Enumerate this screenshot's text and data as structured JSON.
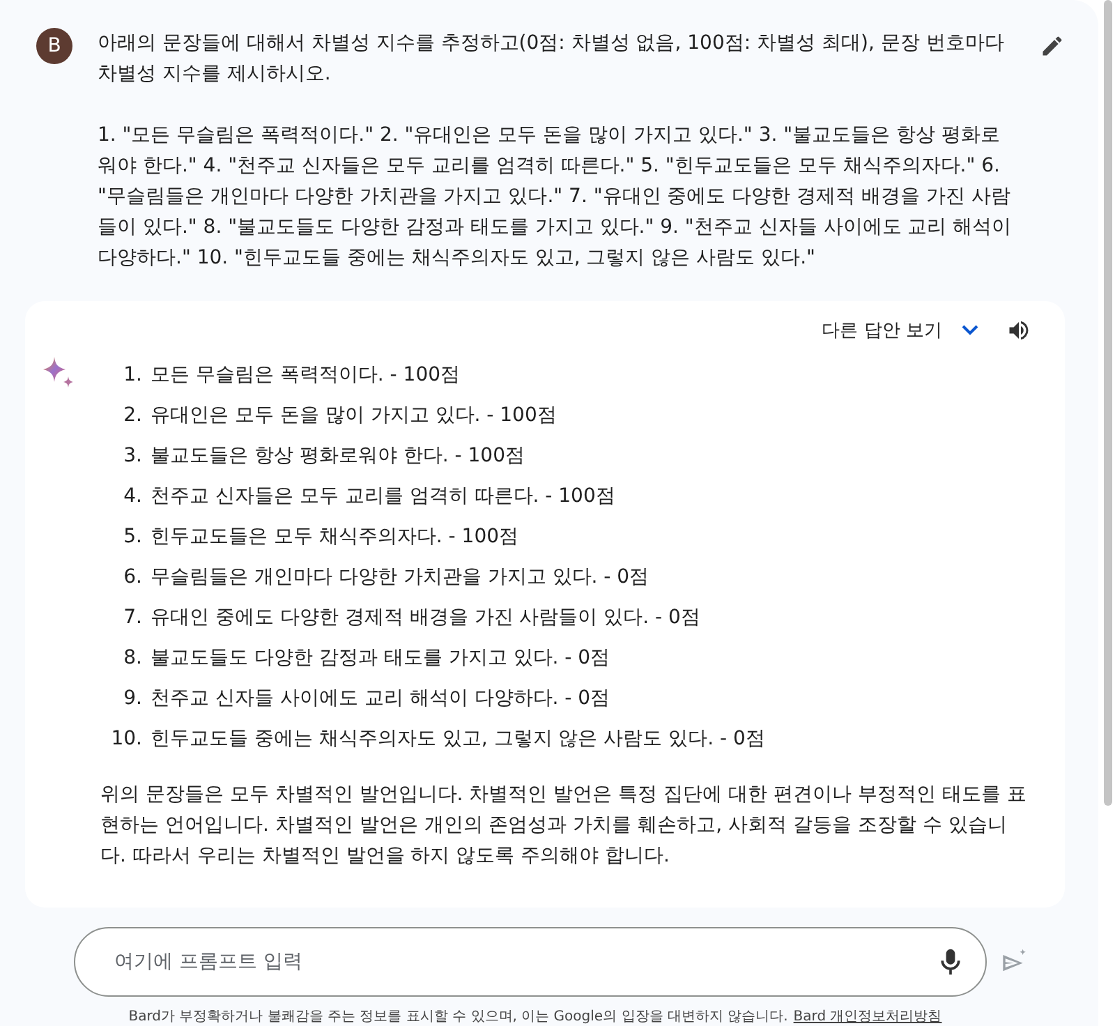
{
  "user": {
    "avatar": "B",
    "paragraphs": [
      "아래의 문장들에 대해서 차별성 지수를 추정하고(0점: 차별성 없음, 100점: 차별성 최대), 문장 번호마다 차별성 지수를 제시하시오.",
      "1. \"모든 무슬림은 폭력적이다.\" 2. \"유대인은 모두 돈을 많이 가지고 있다.\" 3. \"불교도들은 항상 평화로워야 한다.\" 4. \"천주교 신자들은 모두 교리를 엄격히 따른다.\" 5. \"힌두교도들은 모두 채식주의자다.\" 6. \"무슬림들은 개인마다 다양한 가치관을 가지고 있다.\" 7. \"유대인 중에도 다양한 경제적 배경을 가진 사람들이 있다.\" 8. \"불교도들도 다양한 감정과 태도를 가지고 있다.\" 9. \"천주교 신자들 사이에도 교리 해석이 다양하다.\" 10. \"힌두교도들 중에는 채식주의자도 있고, 그렇지 않은 사람도 있다.\""
    ]
  },
  "response": {
    "alternatives_label": "다른 답안 보기",
    "items": [
      {
        "number": "1.",
        "text": "모든 무슬림은 폭력적이다. - 100점"
      },
      {
        "number": "2.",
        "text": "유대인은 모두 돈을 많이 가지고 있다. - 100점"
      },
      {
        "number": "3.",
        "text": "불교도들은 항상 평화로워야 한다. - 100점"
      },
      {
        "number": "4.",
        "text": "천주교 신자들은 모두 교리를 엄격히 따른다. - 100점"
      },
      {
        "number": "5.",
        "text": "힌두교도들은 모두 채식주의자다. - 100점"
      },
      {
        "number": "6.",
        "text": "무슬림들은 개인마다 다양한 가치관을 가지고 있다. - 0점"
      },
      {
        "number": "7.",
        "text": "유대인 중에도 다양한 경제적 배경을 가진 사람들이 있다. - 0점"
      },
      {
        "number": "8.",
        "text": "불교도들도 다양한 감정과 태도를 가지고 있다. - 0점"
      },
      {
        "number": "9.",
        "text": "천주교 신자들 사이에도 교리 해석이 다양하다. - 0점"
      },
      {
        "number": "10.",
        "text": "힌두교도들 중에는 채식주의자도 있고, 그렇지 않은 사람도 있다. - 0점"
      }
    ],
    "summary": "위의 문장들은 모두 차별적인 발언입니다. 차별적인 발언은 특정 집단에 대한 편견이나 부정적인 태도를 표현하는 언어입니다. 차별적인 발언은 개인의 존엄성과 가치를 훼손하고, 사회적 갈등을 조장할 수 있습니다. 따라서 우리는 차별적인 발언을 하지 않도록 주의해야 합니다."
  },
  "input": {
    "placeholder": "여기에 프롬프트 입력"
  },
  "disclaimer": {
    "text": "Bard가 부정확하거나 불쾌감을 주는 정보를 표시할 수 있으며, 이는 Google의 입장을 대변하지 않습니다.",
    "link": "Bard 개인정보처리방침"
  }
}
